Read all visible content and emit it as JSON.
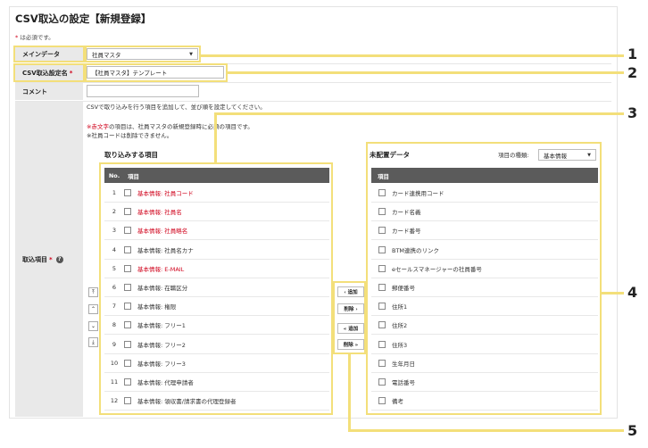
{
  "header": {
    "title": "CSV取込の設定【新規登録】",
    "required_star": "*",
    "required_note": " は必須です。"
  },
  "form": {
    "main_data": {
      "label": "メインデータ",
      "value": "社員マスタ"
    },
    "setting_name": {
      "label": "CSV取込設定名",
      "star": "*",
      "value": "【社員マスタ】テンプレート"
    },
    "comment": {
      "label": "コメント",
      "value": ""
    },
    "import_items": {
      "label": "取込項目",
      "star": "*"
    }
  },
  "info": {
    "line1": "CSVで取り込みを行う項目を追加して、並び順を設定してください。",
    "line2_red": "※赤文字",
    "line2_rest": "の項目は、社員マスタの新規登録時に必須の項目です。",
    "line3": "※社員コードは削除できません。"
  },
  "left_list": {
    "title": "取り込みする項目",
    "headers": {
      "no": "No.",
      "item": "項目"
    },
    "items": [
      {
        "no": "1",
        "label": "基本情報: 社員コード",
        "required": true
      },
      {
        "no": "2",
        "label": "基本情報: 社員名",
        "required": true
      },
      {
        "no": "3",
        "label": "基本情報: 社員略名",
        "required": true
      },
      {
        "no": "4",
        "label": "基本情報: 社員名カナ",
        "required": false
      },
      {
        "no": "5",
        "label": "基本情報: E-MAIL",
        "required": true
      },
      {
        "no": "6",
        "label": "基本情報: 在職区分",
        "required": false
      },
      {
        "no": "7",
        "label": "基本情報: 権限",
        "required": false
      },
      {
        "no": "8",
        "label": "基本情報: フリー1",
        "required": false
      },
      {
        "no": "9",
        "label": "基本情報: フリー2",
        "required": false
      },
      {
        "no": "10",
        "label": "基本情報: フリー3",
        "required": false
      },
      {
        "no": "11",
        "label": "基本情報: 代理申請者",
        "required": false
      },
      {
        "no": "12",
        "label": "基本情報: 領収書/請求書の代理登録者",
        "required": false
      }
    ]
  },
  "move_buttons": {
    "add": "‹ 追加",
    "remove": "削除 ›",
    "add_all": "« 追加",
    "remove_all": "削除 »"
  },
  "order_buttons": {
    "top": "⤒",
    "up": "⌃",
    "down": "⌄",
    "bottom": "⤓"
  },
  "right_list": {
    "title": "未配置データ",
    "type_label": "項目の種類:",
    "type_value": "基本情報",
    "header": "項目",
    "items": [
      "カード連携用コード",
      "カード名義",
      "カード番号",
      "BTM連携のリンク",
      "eセールスマネージャーの社員番号",
      "郵便番号",
      "住所1",
      "住所2",
      "住所3",
      "生年月日",
      "電話番号",
      "備考"
    ]
  },
  "callouts": [
    "1",
    "2",
    "3",
    "4",
    "5"
  ],
  "colors": {
    "highlight": "#f3df7a",
    "required_red": "#d0021b",
    "table_header": "#5b5b5b"
  }
}
